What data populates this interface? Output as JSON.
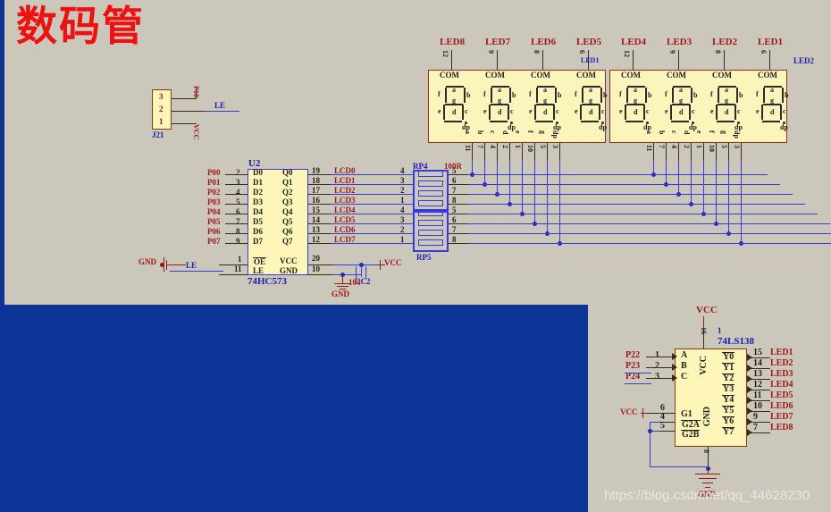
{
  "page": {
    "title_cn": "数码管",
    "background_color": "#cbc8bb",
    "overlay_color": "#0a3596",
    "watermark": "https://blog.csdn.net/qq_44628230"
  },
  "connector_j21": {
    "designator": "J21",
    "pins": [
      "3",
      "2",
      "1"
    ],
    "nets": [
      "P10",
      "LE",
      "VCC"
    ]
  },
  "latch_u2": {
    "designator": "U2",
    "part": "74HC573",
    "left_nets": [
      "P00",
      "P01",
      "P02",
      "P03",
      "P04",
      "P05",
      "P06",
      "P07"
    ],
    "left_pins": [
      "2",
      "3",
      "4",
      "5",
      "6",
      "7",
      "8",
      "9"
    ],
    "left_names": [
      "D0",
      "D1",
      "D2",
      "D3",
      "D4",
      "D5",
      "D6",
      "D7"
    ],
    "right_names": [
      "Q0",
      "Q1",
      "Q2",
      "Q3",
      "Q4",
      "Q5",
      "Q6",
      "Q7"
    ],
    "right_pins": [
      "19",
      "18",
      "17",
      "16",
      "15",
      "14",
      "13",
      "12"
    ],
    "right_nets": [
      "LCD0",
      "LCD1",
      "LCD2",
      "LCD3",
      "LCD4",
      "LCD5",
      "LCD6",
      "LCD7"
    ],
    "oe_name": "OE",
    "oe_pin": "1",
    "oe_net": "GND",
    "le_name": "LE",
    "le_pin": "11",
    "le_net": "LE",
    "vcc_name": "VCC",
    "vcc_pin": "20",
    "vcc_net": "VCC",
    "gnd_name": "GND",
    "gnd_pin": "10",
    "gnd_net": "GND",
    "cap_designator": "CC2",
    "cap_value": "104"
  },
  "respack": {
    "rp4_designator": "RP4",
    "rp4_value": "100R",
    "rp5_designator": "RP5",
    "left_pins": [
      "4",
      "3",
      "2",
      "1",
      "4",
      "3",
      "2",
      "1"
    ],
    "right_pins": [
      "5",
      "6",
      "7",
      "8",
      "5",
      "6",
      "7",
      "8"
    ]
  },
  "displays": {
    "com_label": "COM",
    "segment_letters": [
      "a",
      "b",
      "c",
      "d",
      "e",
      "f",
      "g",
      "dp"
    ],
    "segment_pins": [
      "11",
      "7",
      "4",
      "2",
      "1",
      "10",
      "5",
      "3"
    ],
    "block_left_net": "LED1",
    "block_right_net": "LED2",
    "digits": [
      {
        "name": "LED8",
        "com_pin": "12"
      },
      {
        "name": "LED7",
        "com_pin": "9"
      },
      {
        "name": "LED6",
        "com_pin": "8"
      },
      {
        "name": "LED5",
        "com_pin": "6"
      },
      {
        "name": "LED4",
        "com_pin": "12"
      },
      {
        "name": "LED3",
        "com_pin": "9"
      },
      {
        "name": "LED2",
        "com_pin": "8"
      },
      {
        "name": "LED1",
        "com_pin": "6"
      }
    ]
  },
  "decoder": {
    "designator": "1",
    "part": "74LS138",
    "vcc_net": "VCC",
    "vcc_pin": "16",
    "gnd_net": "GND",
    "gnd_pin": "8",
    "vcc_name": "VCC",
    "gnd_name": "GND",
    "addr_nets": [
      "P22",
      "P23",
      "P24"
    ],
    "addr_pins": [
      "1",
      "2",
      "3"
    ],
    "addr_names": [
      "A",
      "B",
      "C"
    ],
    "enable_pins": [
      "6",
      "4",
      "5"
    ],
    "enable_names": [
      "G1",
      "G2A",
      "G2B"
    ],
    "enable_net": "VCC",
    "out_names": [
      "Y0",
      "Y1",
      "Y2",
      "Y3",
      "Y4",
      "Y5",
      "Y6",
      "Y7"
    ],
    "out_pins": [
      "15",
      "14",
      "13",
      "12",
      "11",
      "10",
      "9",
      "7"
    ],
    "out_nets": [
      "LED1",
      "LED2",
      "LED3",
      "LED4",
      "LED5",
      "LED6",
      "LED7",
      "LED8"
    ]
  }
}
